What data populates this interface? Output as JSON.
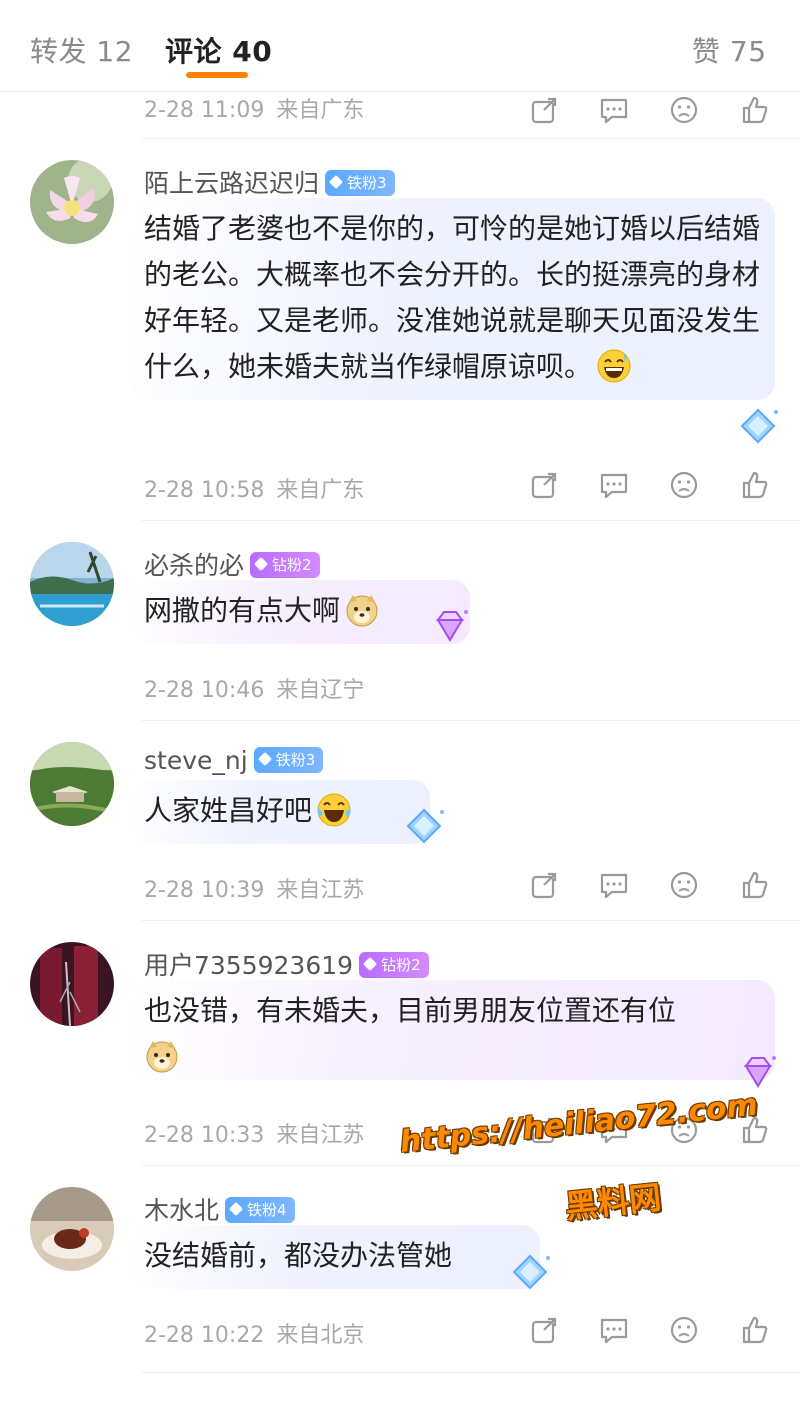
{
  "tabs": {
    "repost": "转发 12",
    "comments": "评论 40",
    "likes": "赞 75"
  },
  "accent_color": "#ff8200",
  "top_meta": {
    "time": "2-28 11:09",
    "location": "来自广东"
  },
  "comments": [
    {
      "username": "陌上云路迟迟归",
      "badge": "铁粉3",
      "text": "结婚了老婆也不是你的，可怜的是她订婚以后结婚的老公。大概率也不会分开的。长的挺漂亮的身材好年轻。又是老师。没准她说就是聊天见面没发生什么，她未婚夫就当作绿帽原谅呗。",
      "emoji": "grinning-sweat-emoji",
      "time": "2-28 10:58",
      "location": "来自广东"
    },
    {
      "username": "必杀的必",
      "badge": "钻粉2",
      "text": "网撒的有点大啊",
      "emoji": "doge-emoji",
      "time": "2-28 10:46",
      "location": "来自辽宁"
    },
    {
      "username": "steve_nj",
      "badge": "铁粉3",
      "text": "人家姓昌好吧",
      "emoji": "laugh-cry-emoji",
      "time": "2-28 10:39",
      "location": "来自江苏"
    },
    {
      "username": "用户7355923619",
      "badge": "钻粉2",
      "text": "也没错，有未婚夫，目前男朋友位置还有位",
      "emoji": "doge-emoji",
      "time": "2-28 10:33",
      "location": "来自江苏"
    },
    {
      "username": "木水北",
      "badge": "铁粉4",
      "text": "没结婚前，都没办法管她",
      "emoji": "",
      "time": "2-28 10:22",
      "location": "来自北京"
    }
  ],
  "action_icons": [
    "share-icon",
    "comment-icon",
    "dislike-icon",
    "like-icon"
  ],
  "watermark": {
    "url": "https://heiliao72.com",
    "name": "黑料网"
  }
}
